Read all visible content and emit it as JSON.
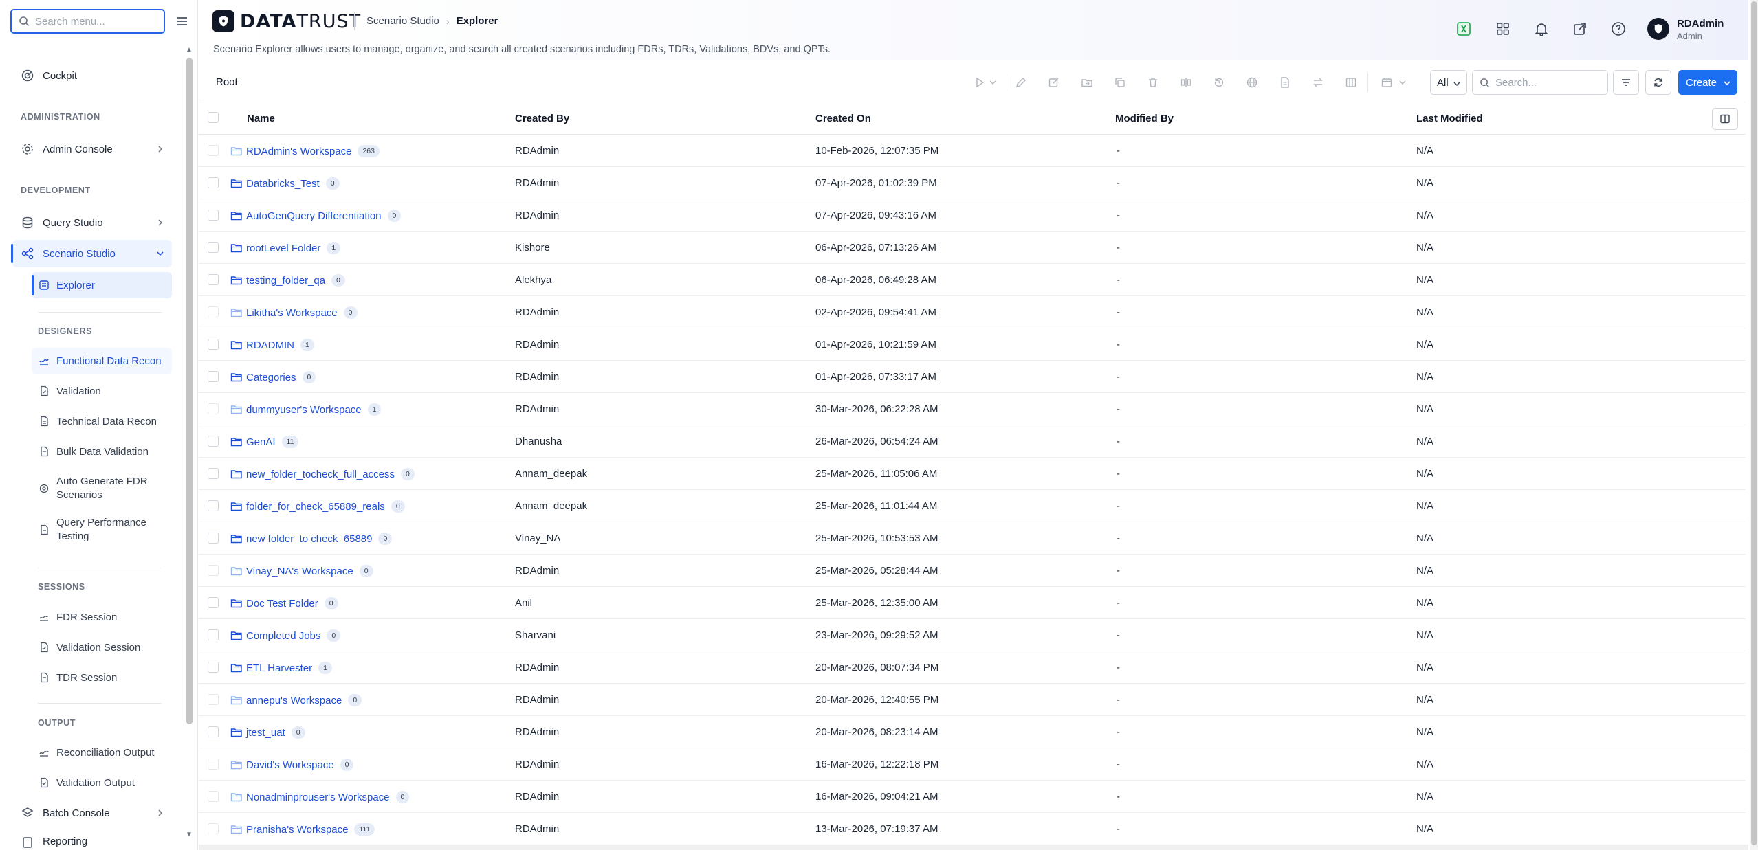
{
  "sidebar": {
    "search_placeholder": "Search menu...",
    "items": {
      "cockpit": "Cockpit",
      "admin_section": "ADMINISTRATION",
      "admin_console": "Admin Console",
      "dev_section": "DEVELOPMENT",
      "query_studio": "Query Studio",
      "scenario_studio": "Scenario Studio",
      "explorer": "Explorer",
      "designers_section": "DESIGNERS",
      "functional_data_recon": "Functional Data Recon",
      "validation": "Validation",
      "technical_data_recon": "Technical Data Recon",
      "bulk_data_validation": "Bulk Data Validation",
      "auto_generate_fdr_1": "Auto Generate FDR",
      "auto_generate_fdr_2": "Scenarios",
      "query_perf_1": "Query Performance",
      "query_perf_2": "Testing",
      "sessions_section": "SESSIONS",
      "fdr_session": "FDR Session",
      "validation_session": "Validation Session",
      "tdr_session": "TDR Session",
      "output_section": "OUTPUT",
      "reconciliation_output": "Reconciliation Output",
      "validation_output": "Validation Output",
      "batch_console": "Batch Console",
      "reporting": "Reporting"
    }
  },
  "header": {
    "logo_prefix": "DATA",
    "logo_suffix": "TRUST",
    "breadcrumb_parent": "Scenario Studio",
    "breadcrumb_current": "Explorer",
    "description": "Scenario Explorer allows users to manage, organize, and search all created scenarios including FDRs, TDRs, Validations, BDVs, and QPTs.",
    "user_name": "RDAdmin",
    "user_role": "Admin"
  },
  "toolbar": {
    "root_label": "Root",
    "filter_value": "All",
    "search_placeholder": "Search...",
    "create_label": "Create"
  },
  "table": {
    "columns": [
      "Name",
      "Created By",
      "Created On",
      "Modified By",
      "Last Modified"
    ],
    "rows": [
      {
        "name": "RDAdmin's Workspace",
        "count": "263",
        "created_by": "RDAdmin",
        "created_on": "10-Feb-2026, 12:07:35 PM",
        "modified_by": "-",
        "last_modified": "N/A",
        "faded": true
      },
      {
        "name": "Databricks_Test",
        "count": "0",
        "created_by": "RDAdmin",
        "created_on": "07-Apr-2026, 01:02:39 PM",
        "modified_by": "-",
        "last_modified": "N/A",
        "faded": false
      },
      {
        "name": "AutoGenQuery Differentiation",
        "count": "0",
        "created_by": "RDAdmin",
        "created_on": "07-Apr-2026, 09:43:16 AM",
        "modified_by": "-",
        "last_modified": "N/A",
        "faded": false
      },
      {
        "name": "rootLevel Folder",
        "count": "1",
        "created_by": "Kishore",
        "created_on": "06-Apr-2026, 07:13:26 AM",
        "modified_by": "-",
        "last_modified": "N/A",
        "faded": false
      },
      {
        "name": "testing_folder_qa",
        "count": "0",
        "created_by": "Alekhya",
        "created_on": "06-Apr-2026, 06:49:28 AM",
        "modified_by": "-",
        "last_modified": "N/A",
        "faded": false
      },
      {
        "name": "Likitha's Workspace",
        "count": "0",
        "created_by": "RDAdmin",
        "created_on": "02-Apr-2026, 09:54:41 AM",
        "modified_by": "-",
        "last_modified": "N/A",
        "faded": true
      },
      {
        "name": "RDADMIN",
        "count": "1",
        "created_by": "RDAdmin",
        "created_on": "01-Apr-2026, 10:21:59 AM",
        "modified_by": "-",
        "last_modified": "N/A",
        "faded": false
      },
      {
        "name": "Categories",
        "count": "0",
        "created_by": "RDAdmin",
        "created_on": "01-Apr-2026, 07:33:17 AM",
        "modified_by": "-",
        "last_modified": "N/A",
        "faded": false
      },
      {
        "name": "dummyuser's Workspace",
        "count": "1",
        "created_by": "RDAdmin",
        "created_on": "30-Mar-2026, 06:22:28 AM",
        "modified_by": "-",
        "last_modified": "N/A",
        "faded": true
      },
      {
        "name": "GenAI",
        "count": "11",
        "created_by": "Dhanusha",
        "created_on": "26-Mar-2026, 06:54:24 AM",
        "modified_by": "-",
        "last_modified": "N/A",
        "faded": false
      },
      {
        "name": "new_folder_tocheck_full_access",
        "count": "0",
        "created_by": "Annam_deepak",
        "created_on": "25-Mar-2026, 11:05:06 AM",
        "modified_by": "-",
        "last_modified": "N/A",
        "faded": false
      },
      {
        "name": "folder_for_check_65889_reals",
        "count": "0",
        "created_by": "Annam_deepak",
        "created_on": "25-Mar-2026, 11:01:44 AM",
        "modified_by": "-",
        "last_modified": "N/A",
        "faded": false
      },
      {
        "name": "new folder_to check_65889",
        "count": "0",
        "created_by": "Vinay_NA",
        "created_on": "25-Mar-2026, 10:53:53 AM",
        "modified_by": "-",
        "last_modified": "N/A",
        "faded": false
      },
      {
        "name": "Vinay_NA's Workspace",
        "count": "0",
        "created_by": "RDAdmin",
        "created_on": "25-Mar-2026, 05:28:44 AM",
        "modified_by": "-",
        "last_modified": "N/A",
        "faded": true
      },
      {
        "name": "Doc Test Folder",
        "count": "0",
        "created_by": "Anil",
        "created_on": "25-Mar-2026, 12:35:00 AM",
        "modified_by": "-",
        "last_modified": "N/A",
        "faded": false
      },
      {
        "name": "Completed Jobs",
        "count": "0",
        "created_by": "Sharvani",
        "created_on": "23-Mar-2026, 09:29:52 AM",
        "modified_by": "-",
        "last_modified": "N/A",
        "faded": false
      },
      {
        "name": "ETL Harvester",
        "count": "1",
        "created_by": "RDAdmin",
        "created_on": "20-Mar-2026, 08:07:34 PM",
        "modified_by": "-",
        "last_modified": "N/A",
        "faded": false
      },
      {
        "name": "annepu's Workspace",
        "count": "0",
        "created_by": "RDAdmin",
        "created_on": "20-Mar-2026, 12:40:55 PM",
        "modified_by": "-",
        "last_modified": "N/A",
        "faded": true
      },
      {
        "name": "jtest_uat",
        "count": "0",
        "created_by": "RDAdmin",
        "created_on": "20-Mar-2026, 08:23:14 AM",
        "modified_by": "-",
        "last_modified": "N/A",
        "faded": false
      },
      {
        "name": "David's Workspace",
        "count": "0",
        "created_by": "RDAdmin",
        "created_on": "16-Mar-2026, 12:22:18 PM",
        "modified_by": "-",
        "last_modified": "N/A",
        "faded": true
      },
      {
        "name": "Nonadminprouser's Workspace",
        "count": "0",
        "created_by": "RDAdmin",
        "created_on": "16-Mar-2026, 09:04:21 AM",
        "modified_by": "-",
        "last_modified": "N/A",
        "faded": true
      },
      {
        "name": "Pranisha's Workspace",
        "count": "111",
        "created_by": "RDAdmin",
        "created_on": "13-Mar-2026, 07:19:37 AM",
        "modified_by": "-",
        "last_modified": "N/A",
        "faded": true
      }
    ]
  },
  "colors": {
    "accent": "#1d6ff2",
    "link": "#1d4ed8",
    "active_bg": "#eef4ff",
    "excel_icon": "#16a34a"
  },
  "icons": [
    "search-icon",
    "hamburger-icon",
    "cockpit-icon",
    "gear-icon",
    "database-icon",
    "share-nodes-icon",
    "explorer-icon",
    "folder-icon",
    "bell-icon",
    "grid-icon",
    "help-icon",
    "external-link-icon",
    "refresh-icon",
    "filter-icon",
    "columns-icon",
    "play-icon"
  ]
}
